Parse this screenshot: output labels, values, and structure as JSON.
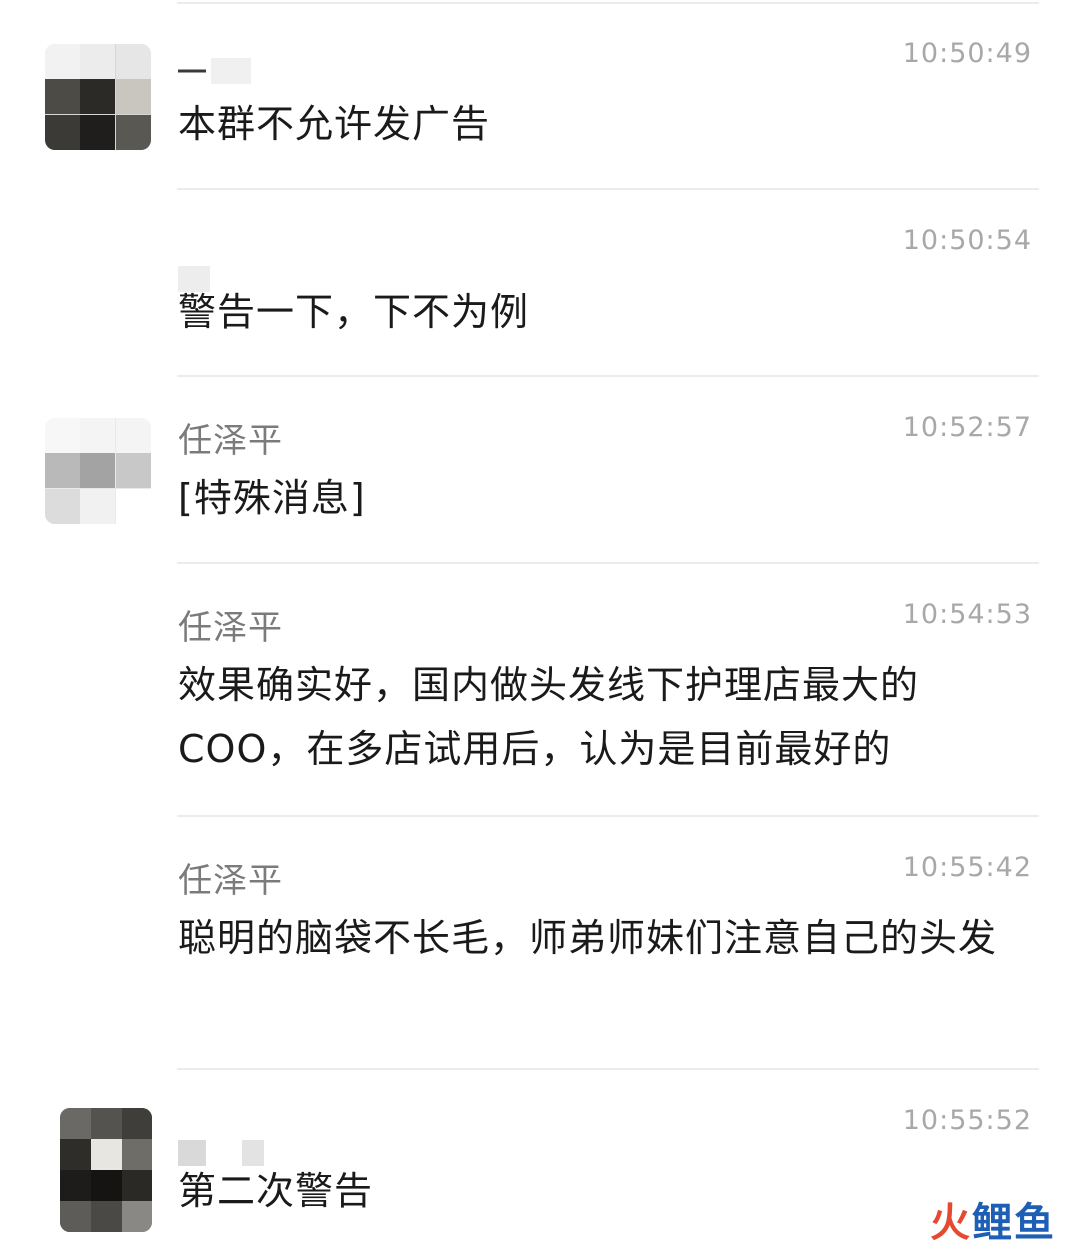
{
  "messages": [
    {
      "sender": "",
      "time": "10:50:49",
      "text": "本群不允许发广告"
    },
    {
      "sender": "",
      "time": "10:50:54",
      "text": "警告一下，下不为例"
    },
    {
      "sender": "任泽平",
      "time": "10:52:57",
      "text": "[特殊消息]"
    },
    {
      "sender": "任泽平",
      "time": "10:54:53",
      "text": "效果确实好，国内做头发线下护理店最大的COO，在多店试用后，认为是目前最好的"
    },
    {
      "sender": "任泽平",
      "time": "10:55:42",
      "text": "聪明的脑袋不长毛，师弟师妹们注意自己的头发"
    },
    {
      "sender": "",
      "time": "10:55:52",
      "text": "第二次警告"
    }
  ],
  "watermark": {
    "part1": "火",
    "part2": "鲤鱼"
  },
  "colors": {
    "divider": "#ececec",
    "sender": "#7b7b7b",
    "time": "#a8a8a8",
    "text": "#1a1a1a"
  }
}
